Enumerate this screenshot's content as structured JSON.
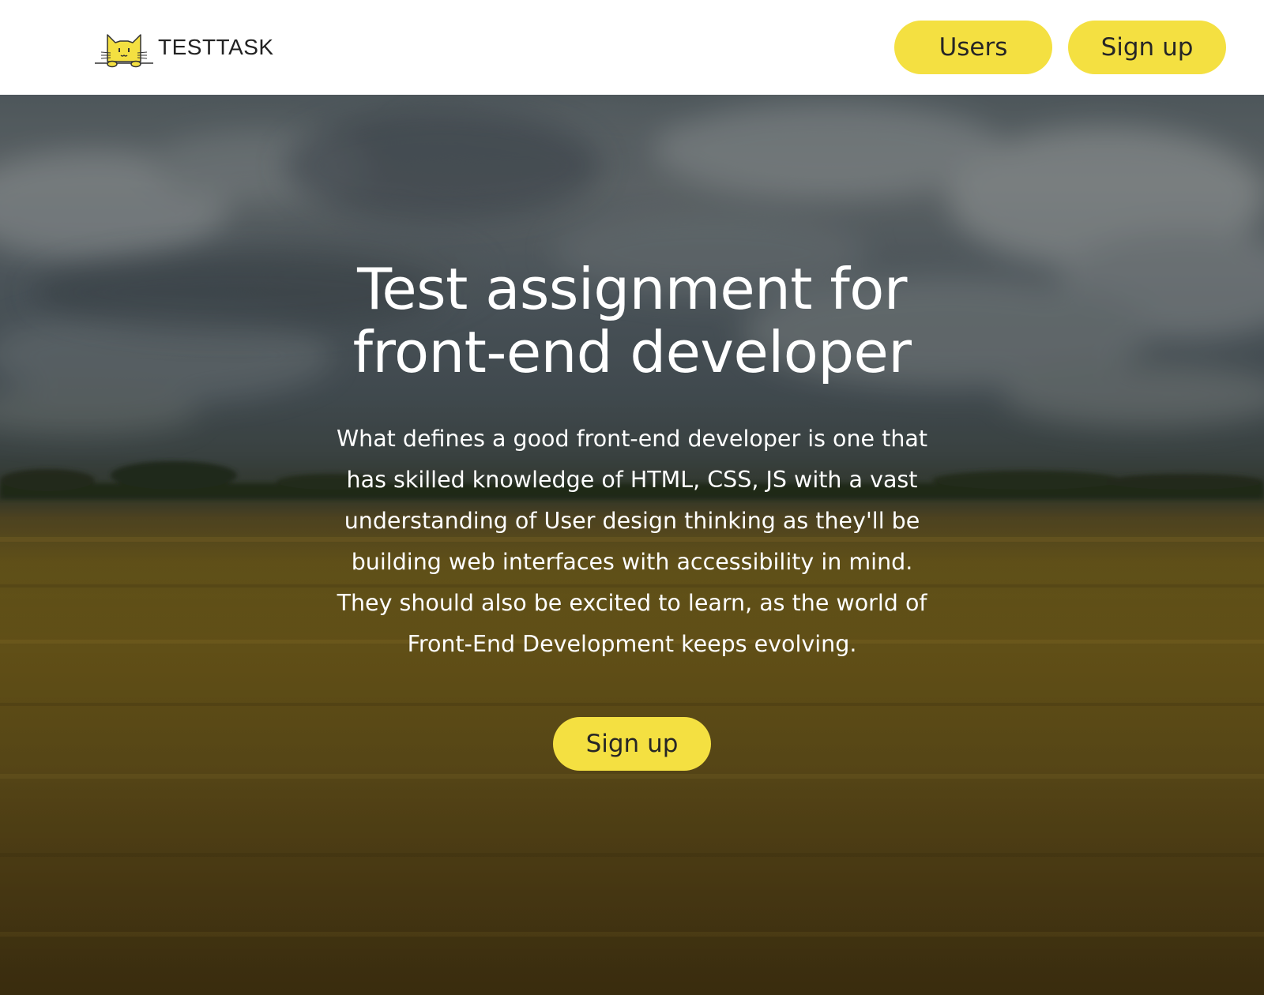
{
  "header": {
    "logo": {
      "icon": "cat-logo-icon",
      "text": "TESTTASK"
    },
    "nav": {
      "users_label": "Users",
      "signup_label": "Sign up"
    }
  },
  "hero": {
    "title": "Test assignment for\nfront-end developer",
    "text": "What defines a good front-end developer is one that\nhas skilled knowledge of HTML, CSS, JS with a vast\nunderstanding of User design thinking as they'll be\nbuilding web interfaces with accessibility in mind.\nThey should also be excited to learn, as the world of\nFront-End Development keeps evolving.",
    "cta_label": "Sign up",
    "background": "wheat-field-under-cloudy-sky"
  },
  "colors": {
    "accent": "#F4E041",
    "text_dark": "#262626",
    "text_light": "#FFFFFF",
    "header_bg": "#FFFFFF"
  }
}
